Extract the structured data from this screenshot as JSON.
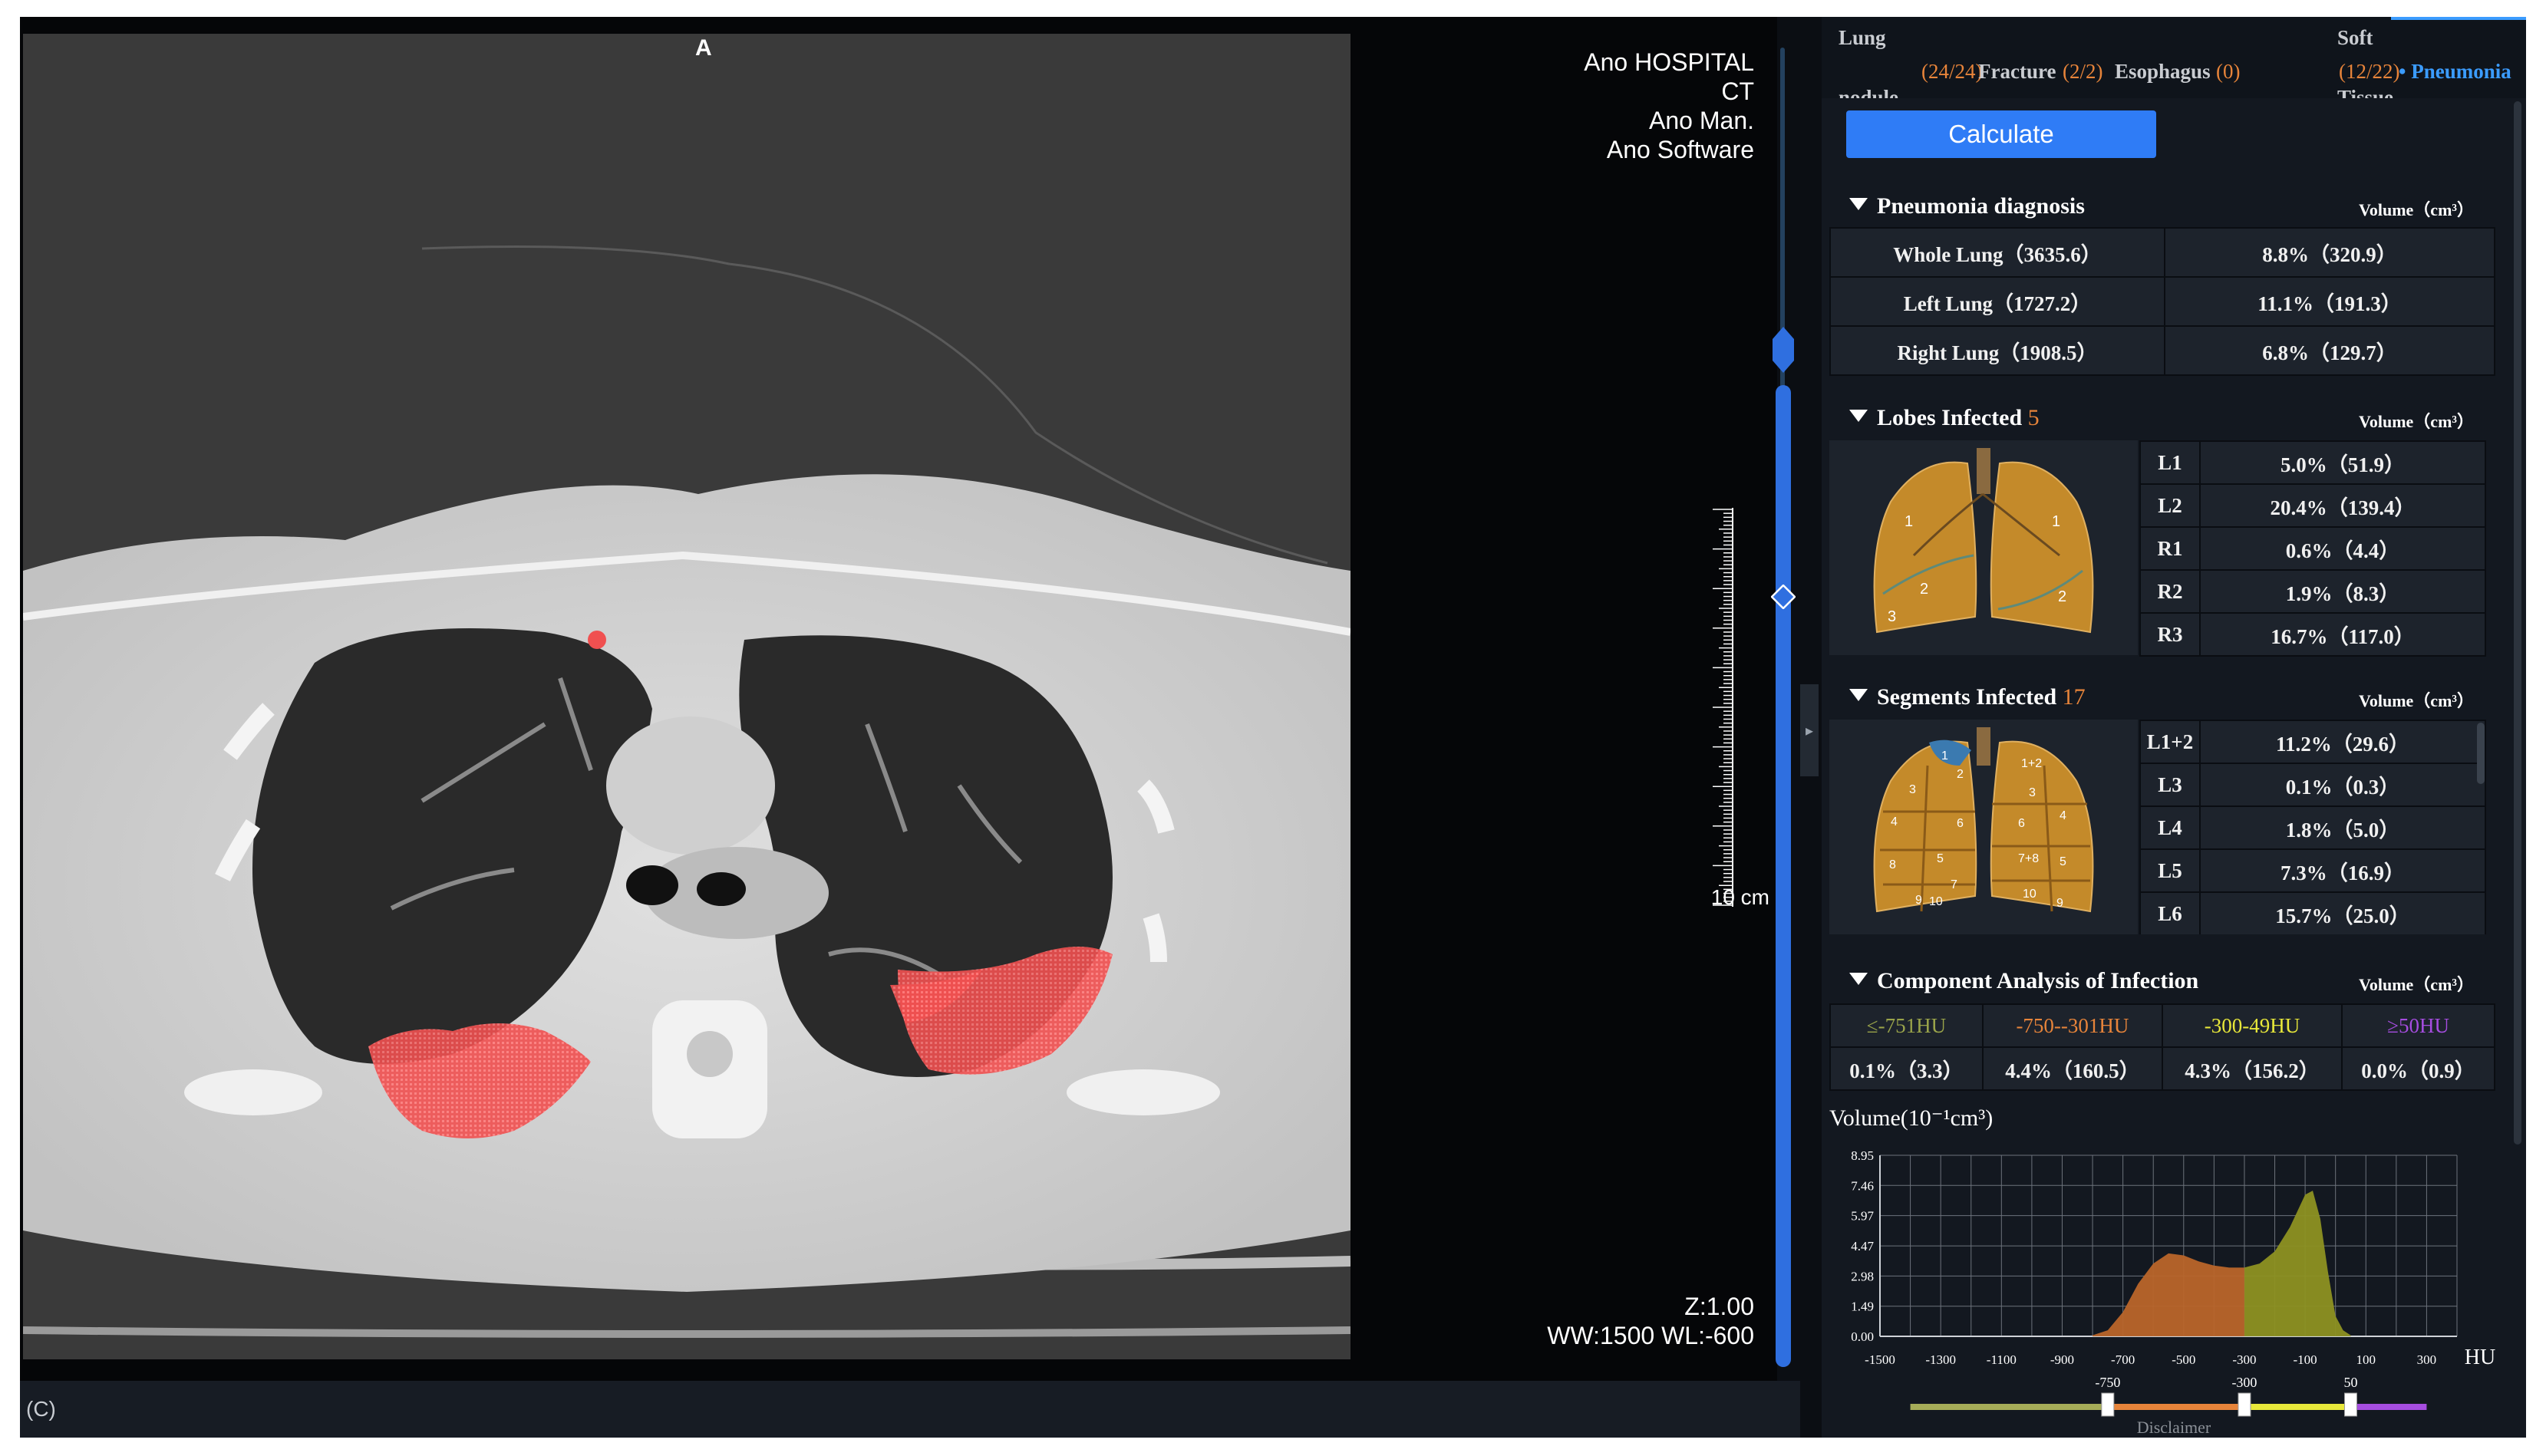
{
  "viewer": {
    "orientation": "A",
    "info_top_right": [
      "Ano HOSPITAL",
      "CT",
      "Ano Man.",
      "Ano Software"
    ],
    "info_bottom_right": [
      "Z:1.00",
      "WW:1500 WL:-600"
    ],
    "scale_label": "10 cm",
    "footer_label": "(C)"
  },
  "tabs": [
    {
      "label_top": "Lung",
      "label_bottom": "nodule",
      "count": "(24/24)"
    },
    {
      "label_top": "Fracture",
      "label_bottom": "",
      "count": "(2/2)"
    },
    {
      "label_top": "Esophagus",
      "label_bottom": "",
      "count": "(0)"
    },
    {
      "label_top": "Soft",
      "label_bottom": "Tissue",
      "count": "(12/22)"
    },
    {
      "label_top": "• Pneumonia",
      "label_bottom": "",
      "count": ""
    }
  ],
  "calculate_label": "Calculate",
  "pneumonia_diagnosis": {
    "title": "Pneumonia diagnosis",
    "unit": "Volume（cm³）",
    "rows": [
      {
        "name": "Whole Lung（3635.6）",
        "value": "8.8%（320.9）"
      },
      {
        "name": "Left Lung（1727.2）",
        "value": "11.1%（191.3）"
      },
      {
        "name": "Right Lung（1908.5）",
        "value": "6.8%（129.7）"
      }
    ]
  },
  "lobes": {
    "title": "Lobes Infected",
    "count": "5",
    "unit": "Volume（cm³）",
    "rows": [
      {
        "name": "L1",
        "value": "5.0%（51.9）"
      },
      {
        "name": "L2",
        "value": "20.4%（139.4）"
      },
      {
        "name": "R1",
        "value": "0.6%（4.4）"
      },
      {
        "name": "R2",
        "value": "1.9%（8.3）"
      },
      {
        "name": "R3",
        "value": "16.7%（117.0）"
      }
    ]
  },
  "segments": {
    "title": "Segments Infected",
    "count": "17",
    "unit": "Volume（cm³）",
    "rows": [
      {
        "name": "L1+2",
        "value": "11.2%（29.6）"
      },
      {
        "name": "L3",
        "value": "0.1%（0.3）"
      },
      {
        "name": "L4",
        "value": "1.8%（5.0）"
      },
      {
        "name": "L5",
        "value": "7.3%（16.9）"
      },
      {
        "name": "L6",
        "value": "15.7%（25.0）"
      }
    ]
  },
  "component": {
    "title": "Component Analysis of Infection",
    "unit": "Volume（cm³）",
    "ranges": [
      {
        "label": "≤-751HU",
        "value": "0.1%（3.3）",
        "color": "#9aa44a"
      },
      {
        "label": "-750--301HU",
        "value": "4.4%（160.5）",
        "color": "#e7843a"
      },
      {
        "label": "-300-49HU",
        "value": "4.3%（156.2）",
        "color": "#e8e83a"
      },
      {
        "label": "≥50HU",
        "value": "0.0%（0.9）",
        "color": "#a64de0"
      }
    ]
  },
  "chart_data": {
    "type": "area",
    "title": "",
    "ylabel": "Volume(10⁻¹cm³)",
    "xlabel": "HU",
    "x_ticks": [
      "-1500",
      "-1300",
      "-1100",
      "-900",
      "-700",
      "-500",
      "-300",
      "-100",
      "100",
      "300"
    ],
    "y_ticks": [
      "0.00",
      "1.49",
      "2.98",
      "4.47",
      "5.97",
      "7.46",
      "8.95"
    ],
    "xlim": [
      -1500,
      400
    ],
    "ylim": [
      0,
      8.95
    ],
    "series": [
      {
        "color": "#b9652a",
        "x": [
          -800,
          -750,
          -700,
          -650,
          -600,
          -550,
          -500,
          -450,
          -400,
          -350,
          -300
        ],
        "y": [
          0.05,
          0.3,
          1.2,
          2.6,
          3.6,
          4.1,
          4.0,
          3.7,
          3.5,
          3.4,
          3.4
        ]
      },
      {
        "color": "#8d9122",
        "x": [
          -300,
          -250,
          -200,
          -150,
          -100,
          -75,
          -50,
          -25,
          0,
          25,
          50
        ],
        "y": [
          3.4,
          3.6,
          4.2,
          5.4,
          7.0,
          7.2,
          5.8,
          3.2,
          1.0,
          0.3,
          0.05
        ]
      }
    ]
  },
  "range_slider": {
    "handles": [
      -750,
      -300,
      50
    ],
    "handle_labels": [
      "-750",
      "-300",
      "50"
    ],
    "colors": [
      "#a6ac58",
      "#e7843a",
      "#e8e83a",
      "#a64de0"
    ]
  },
  "disclaimer": "Disclaimer"
}
